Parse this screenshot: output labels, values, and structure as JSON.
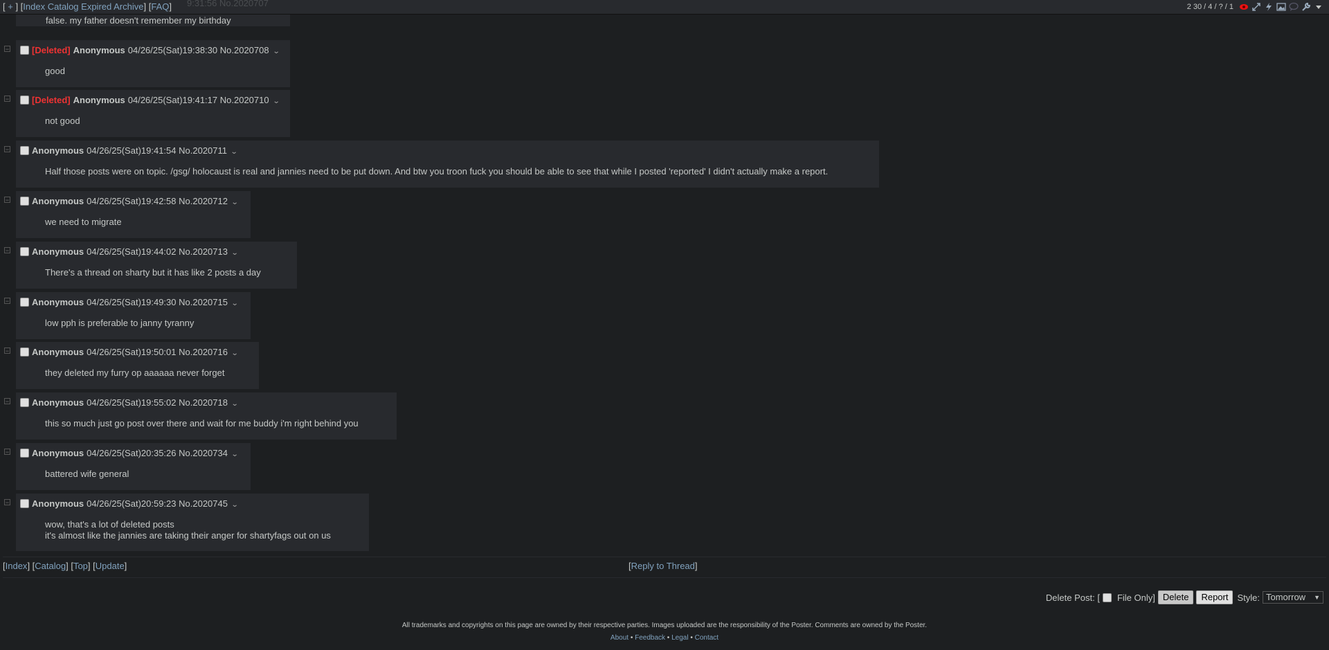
{
  "topbar": {
    "plus": "+",
    "links": [
      "Index",
      "Catalog",
      "Expired",
      "Archive"
    ],
    "faq": "FAQ",
    "stats": "2 30 / 4 / ? / 1"
  },
  "ghost_header": "9:31:56 No.2020707",
  "first_post_tail": "false. my father doesn't remember my birthday",
  "posts": [
    {
      "deleted": "[Deleted]",
      "name": "Anonymous",
      "datetime": "04/26/25(Sat)19:38:30",
      "num": "No.2020708",
      "body": "good"
    },
    {
      "deleted": "[Deleted]",
      "name": "Anonymous",
      "datetime": "04/26/25(Sat)19:41:17",
      "num": "No.2020710",
      "body": "not good"
    },
    {
      "deleted": "",
      "name": "Anonymous",
      "datetime": "04/26/25(Sat)19:41:54",
      "num": "No.2020711",
      "body": "Half those posts were on topic. /gsg/ holocaust is real and jannies need to be put down. And btw you troon fuck you should be able to see that while I posted 'reported' I didn't actually make a report."
    },
    {
      "deleted": "",
      "name": "Anonymous",
      "datetime": "04/26/25(Sat)19:42:58",
      "num": "No.2020712",
      "body": "we need to migrate"
    },
    {
      "deleted": "",
      "name": "Anonymous",
      "datetime": "04/26/25(Sat)19:44:02",
      "num": "No.2020713",
      "body": "There's a thread on sharty but it has like 2 posts a day"
    },
    {
      "deleted": "",
      "name": "Anonymous",
      "datetime": "04/26/25(Sat)19:49:30",
      "num": "No.2020715",
      "body": "low pph is preferable to janny tyranny"
    },
    {
      "deleted": "",
      "name": "Anonymous",
      "datetime": "04/26/25(Sat)19:50:01",
      "num": "No.2020716",
      "body": "they deleted my furry op aaaaaa never forget"
    },
    {
      "deleted": "",
      "name": "Anonymous",
      "datetime": "04/26/25(Sat)19:55:02",
      "num": "No.2020718",
      "body": "this so much just go post over there and wait for me buddy i'm right behind you"
    },
    {
      "deleted": "",
      "name": "Anonymous",
      "datetime": "04/26/25(Sat)20:35:26",
      "num": "No.2020734",
      "body": "battered wife general"
    },
    {
      "deleted": "",
      "name": "Anonymous",
      "datetime": "04/26/25(Sat)20:59:23",
      "num": "No.2020745",
      "body": "wow, that's a lot of deleted posts\nit's almost like the jannies are taking their anger for shartyfags out on us"
    }
  ],
  "bottom_nav": {
    "index": "Index",
    "catalog": "Catalog",
    "top": "Top",
    "update": "Update"
  },
  "reply_to_thread": "Reply to Thread",
  "delete_form": {
    "label": "Delete Post: [",
    "file_only": "File Only]",
    "delete": "Delete",
    "report": "Report",
    "style_label": "Style:",
    "style_value": "Tomorrow"
  },
  "footer": {
    "notice": "All trademarks and copyrights on this page are owned by their respective parties. Images uploaded are the responsibility of the Poster. Comments are owned by the Poster.",
    "links": [
      "About",
      "Feedback",
      "Legal",
      "Contact"
    ]
  },
  "colors": {
    "background": "#1d1f21",
    "post": "#282a2e",
    "link": "#81a2be",
    "deleted": "#e33333",
    "text": "#c5c8c6"
  },
  "icons": [
    "eye-icon",
    "expand-icon",
    "lightning-icon",
    "image-icon",
    "speech-bubble-icon",
    "wrench-icon",
    "chevron-down-icon"
  ]
}
